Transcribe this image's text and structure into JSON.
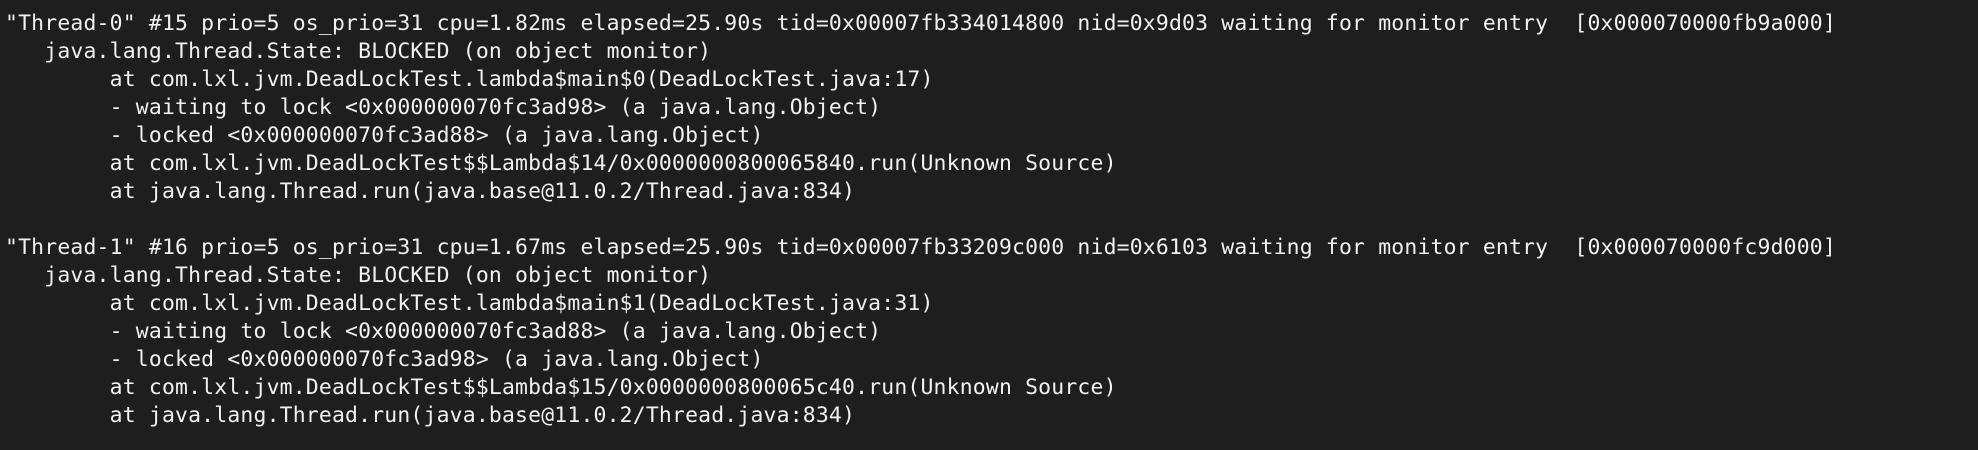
{
  "terminal": {
    "blocks": [
      {
        "lines": [
          "\"Thread-0\" #15 prio=5 os_prio=31 cpu=1.82ms elapsed=25.90s tid=0x00007fb334014800 nid=0x9d03 waiting for monitor entry  [0x000070000fb9a000]",
          "   java.lang.Thread.State: BLOCKED (on object monitor)",
          "        at com.lxl.jvm.DeadLockTest.lambda$main$0(DeadLockTest.java:17)",
          "        - waiting to lock <0x000000070fc3ad98> (a java.lang.Object)",
          "        - locked <0x000000070fc3ad88> (a java.lang.Object)",
          "        at com.lxl.jvm.DeadLockTest$$Lambda$14/0x0000000800065840.run(Unknown Source)",
          "        at java.lang.Thread.run(java.base@11.0.2/Thread.java:834)"
        ]
      },
      {
        "lines": [
          "\"Thread-1\" #16 prio=5 os_prio=31 cpu=1.67ms elapsed=25.90s tid=0x00007fb33209c000 nid=0x6103 waiting for monitor entry  [0x000070000fc9d000]",
          "   java.lang.Thread.State: BLOCKED (on object monitor)",
          "        at com.lxl.jvm.DeadLockTest.lambda$main$1(DeadLockTest.java:31)",
          "        - waiting to lock <0x000000070fc3ad88> (a java.lang.Object)",
          "        - locked <0x000000070fc3ad98> (a java.lang.Object)",
          "        at com.lxl.jvm.DeadLockTest$$Lambda$15/0x0000000800065c40.run(Unknown Source)",
          "        at java.lang.Thread.run(java.base@11.0.2/Thread.java:834)"
        ]
      }
    ],
    "colors": {
      "background": "#1e1e1e",
      "text": "#f2f2f2"
    }
  }
}
